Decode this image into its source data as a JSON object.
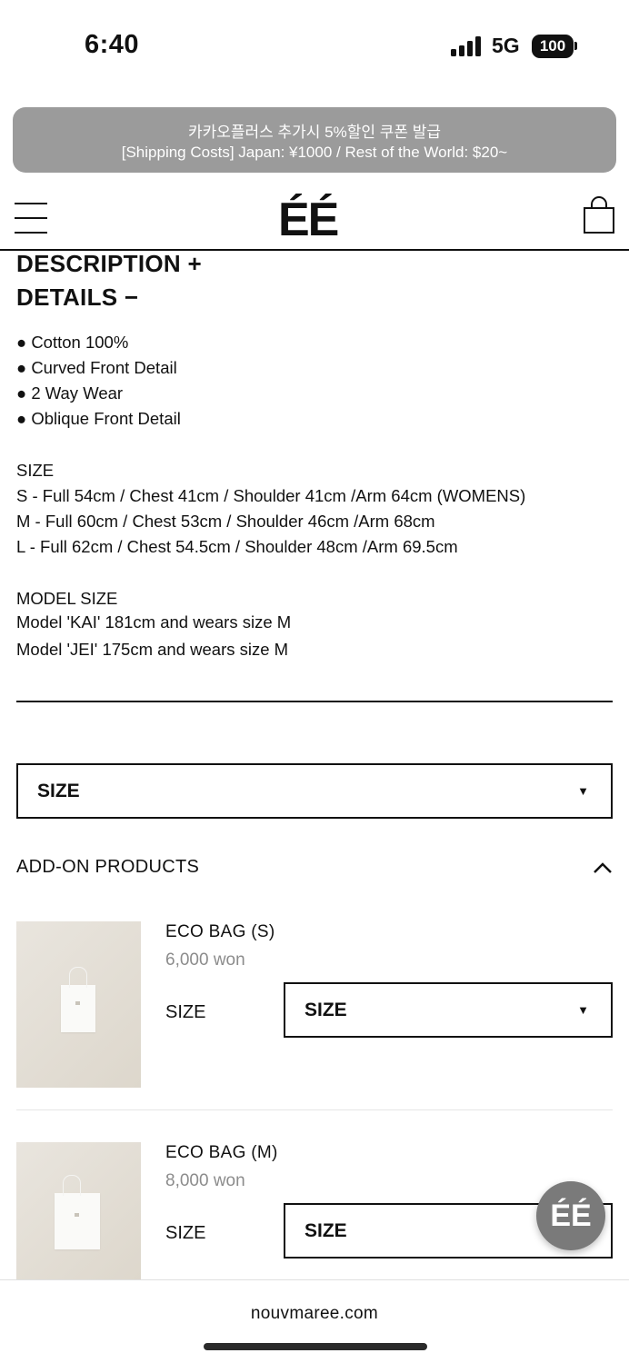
{
  "status_bar": {
    "time": "6:40",
    "network": "5G",
    "battery": "100"
  },
  "banner": {
    "line1": "카카오플러스 추가시 5%할인 쿠폰 발급",
    "line2": "[Shipping Costs] Japan: ¥1000 / Rest of the World: $20~"
  },
  "header": {
    "logo": "ÉÉ"
  },
  "description": {
    "title": "DESCRIPTION +",
    "details_title": "DETAILS −",
    "bullets": [
      "● Cotton 100%",
      "● Curved Front Detail",
      "● 2 Way Wear",
      "● Oblique Front Detail"
    ],
    "size_heading": "SIZE",
    "sizes": [
      "S - Full 54cm / Chest 41cm / Shoulder 41cm /Arm 64cm (WOMENS)",
      "M - Full 60cm / Chest 53cm / Shoulder 46cm /Arm 68cm",
      "L  - Full 62cm / Chest 54.5cm / Shoulder 48cm /Arm 69.5cm"
    ],
    "model_heading": "MODEL SIZE",
    "models": [
      "Model 'KAI' 181cm and wears size M",
      "Model 'JEI' 175cm and wears size M"
    ]
  },
  "size_select": {
    "value": "SIZE",
    "arrow": "▼"
  },
  "addons": {
    "title": "ADD-ON PRODUCTS",
    "products": [
      {
        "name": "ECO BAG (S)",
        "price": "6,000 won",
        "size_label": "SIZE",
        "select_value": "SIZE"
      },
      {
        "name": "ECO BAG (M)",
        "price": "8,000 won",
        "size_label": "SIZE",
        "select_value": "SIZE"
      }
    ]
  },
  "fab": {
    "label": "ÉÉ"
  },
  "browser": {
    "url": "nouvmaree.com"
  }
}
